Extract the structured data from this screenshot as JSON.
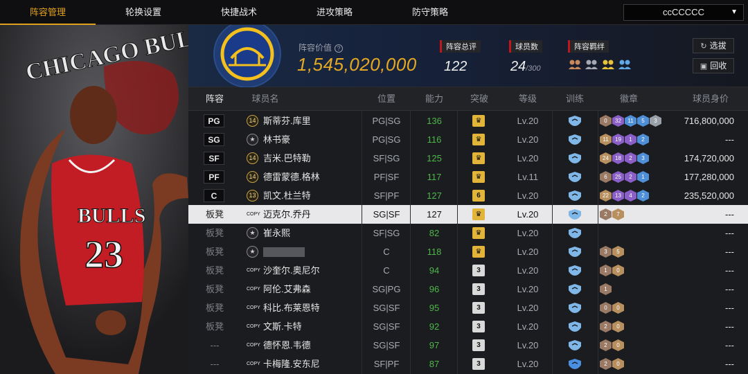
{
  "nav": {
    "tabs": [
      "阵容管理",
      "轮换设置",
      "快捷战术",
      "进攻策略",
      "防守策略"
    ],
    "active_tab": 0,
    "account": "ccCCCCC"
  },
  "header": {
    "team_value_label": "阵容价值",
    "team_value": "1,545,020,000",
    "overall_label": "阵容总评",
    "overall": "122",
    "players_label": "球员数",
    "players": "24",
    "players_max": "/300",
    "bonds_label": "阵容羁绊",
    "btn_recruit": "选拔",
    "btn_recycle": "回收"
  },
  "columns": [
    "阵容",
    "球员名",
    "位置",
    "能力",
    "突破",
    "等级",
    "训练",
    "徽章",
    "球员身价"
  ],
  "rows": [
    {
      "slot": "PG",
      "num": "14",
      "name": "斯蒂芬.库里",
      "pos": "PG|SG",
      "rating": "136",
      "brk": "♛",
      "lv": "Lv.20",
      "badges": [
        "0",
        "32",
        "11",
        "5",
        "3"
      ],
      "price": "716,800,000"
    },
    {
      "slot": "SG",
      "num": "",
      "name": "林书豪",
      "pos": "PG|SG",
      "rating": "116",
      "brk": "♛",
      "lv": "Lv.20",
      "badges": [
        "11",
        "19",
        "1",
        "2"
      ],
      "price": "---"
    },
    {
      "slot": "SF",
      "num": "14",
      "name": "吉米.巴特勒",
      "pos": "SF|SG",
      "rating": "125",
      "brk": "♛",
      "lv": "Lv.20",
      "badges": [
        "24",
        "18",
        "2",
        "3"
      ],
      "price": "174,720,000"
    },
    {
      "slot": "PF",
      "num": "14",
      "name": "德雷蒙德.格林",
      "pos": "PF|SF",
      "rating": "117",
      "brk": "♛",
      "lv": "Lv.11",
      "badges": [
        "6",
        "25",
        "2",
        "1"
      ],
      "price": "177,280,000"
    },
    {
      "slot": "C",
      "num": "13",
      "name": "凯文.杜兰特",
      "pos": "SF|PF",
      "rating": "127",
      "brk": "6",
      "lv": "Lv.20",
      "badges": [
        "22",
        "13",
        "4",
        "2"
      ],
      "price": "235,520,000"
    },
    {
      "slot": "板凳",
      "num": "COPY",
      "name": "迈克尔.乔丹",
      "pos": "SG|SF",
      "rating": "127",
      "brk": "♛",
      "lv": "Lv.20",
      "badges": [
        "2",
        "7"
      ],
      "price": "---"
    },
    {
      "slot": "板凳",
      "num": "",
      "name": "崔永熙",
      "pos": "SF|SG",
      "rating": "82",
      "brk": "♛",
      "lv": "Lv.20",
      "badges": [],
      "price": "---"
    },
    {
      "slot": "板凳",
      "num": "",
      "name": "",
      "pos": "C",
      "rating": "118",
      "brk": "♛",
      "lv": "Lv.20",
      "badges": [
        "3",
        "5"
      ],
      "price": "---"
    },
    {
      "slot": "板凳",
      "num": "COPY",
      "name": "沙奎尔.奥尼尔",
      "pos": "C",
      "rating": "94",
      "brk": "3",
      "lv": "Lv.20",
      "badges": [
        "1",
        "0"
      ],
      "price": "---"
    },
    {
      "slot": "板凳",
      "num": "COPY",
      "name": "阿伦.艾弗森",
      "pos": "SG|PG",
      "rating": "96",
      "brk": "3",
      "lv": "Lv.20",
      "badges": [
        "1"
      ],
      "price": "---"
    },
    {
      "slot": "板凳",
      "num": "COPY",
      "name": "科比.布莱恩特",
      "pos": "SG|SF",
      "rating": "95",
      "brk": "3",
      "lv": "Lv.20",
      "badges": [
        "0",
        "0"
      ],
      "price": "---"
    },
    {
      "slot": "板凳",
      "num": "COPY",
      "name": "文斯.卡特",
      "pos": "SG|SF",
      "rating": "92",
      "brk": "3",
      "lv": "Lv.20",
      "badges": [
        "2",
        "0"
      ],
      "price": "---"
    },
    {
      "slot": "---",
      "num": "COPY",
      "name": "德怀恩.韦德",
      "pos": "SG|SF",
      "rating": "97",
      "brk": "3",
      "lv": "Lv.20",
      "badges": [
        "2",
        "0"
      ],
      "price": "---"
    },
    {
      "slot": "---",
      "num": "COPY",
      "name": "卡梅隆.安东尼",
      "pos": "SF|PF",
      "rating": "87",
      "brk": "3",
      "lv": "Lv.20",
      "badges": [
        "2",
        "0"
      ],
      "price": "---"
    }
  ],
  "portrait": {
    "team_text": "CHICAGO BULLS",
    "jersey": "BULLS",
    "number": "23"
  },
  "colors": {
    "accent": "#e0a21d",
    "rating_green": "#4eb74a",
    "value_gold": "#e3a824"
  }
}
